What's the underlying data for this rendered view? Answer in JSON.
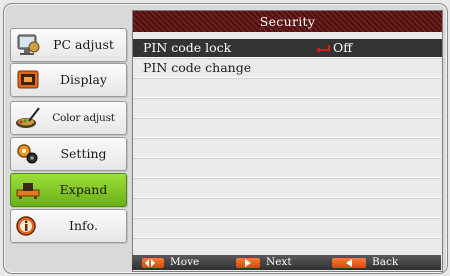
{
  "sidebar": {
    "items": [
      {
        "label": "PC adjust",
        "icon": "pc-adjust-icon",
        "active": false
      },
      {
        "label": "Display",
        "icon": "display-icon",
        "active": false
      },
      {
        "label": "Color adjust",
        "icon": "color-adjust-icon",
        "active": false
      },
      {
        "label": "Setting",
        "icon": "setting-icon",
        "active": false
      },
      {
        "label": "Expand",
        "icon": "expand-icon",
        "active": true
      },
      {
        "label": "Info.",
        "icon": "info-icon",
        "active": false
      }
    ]
  },
  "panel": {
    "title": "Security",
    "rows": [
      {
        "label": "PIN code lock",
        "value": "Off",
        "selected": true
      },
      {
        "label": "PIN code change",
        "value": "",
        "selected": false
      }
    ]
  },
  "footer": {
    "move_label": "Move",
    "next_label": "Next",
    "back_label": "Back"
  },
  "colors": {
    "title_bar": "#6a1616",
    "selected_row": "#333333",
    "active_tab": "#7cc421",
    "footer_key": "#f26522",
    "return_arrow": "#d0221b"
  }
}
